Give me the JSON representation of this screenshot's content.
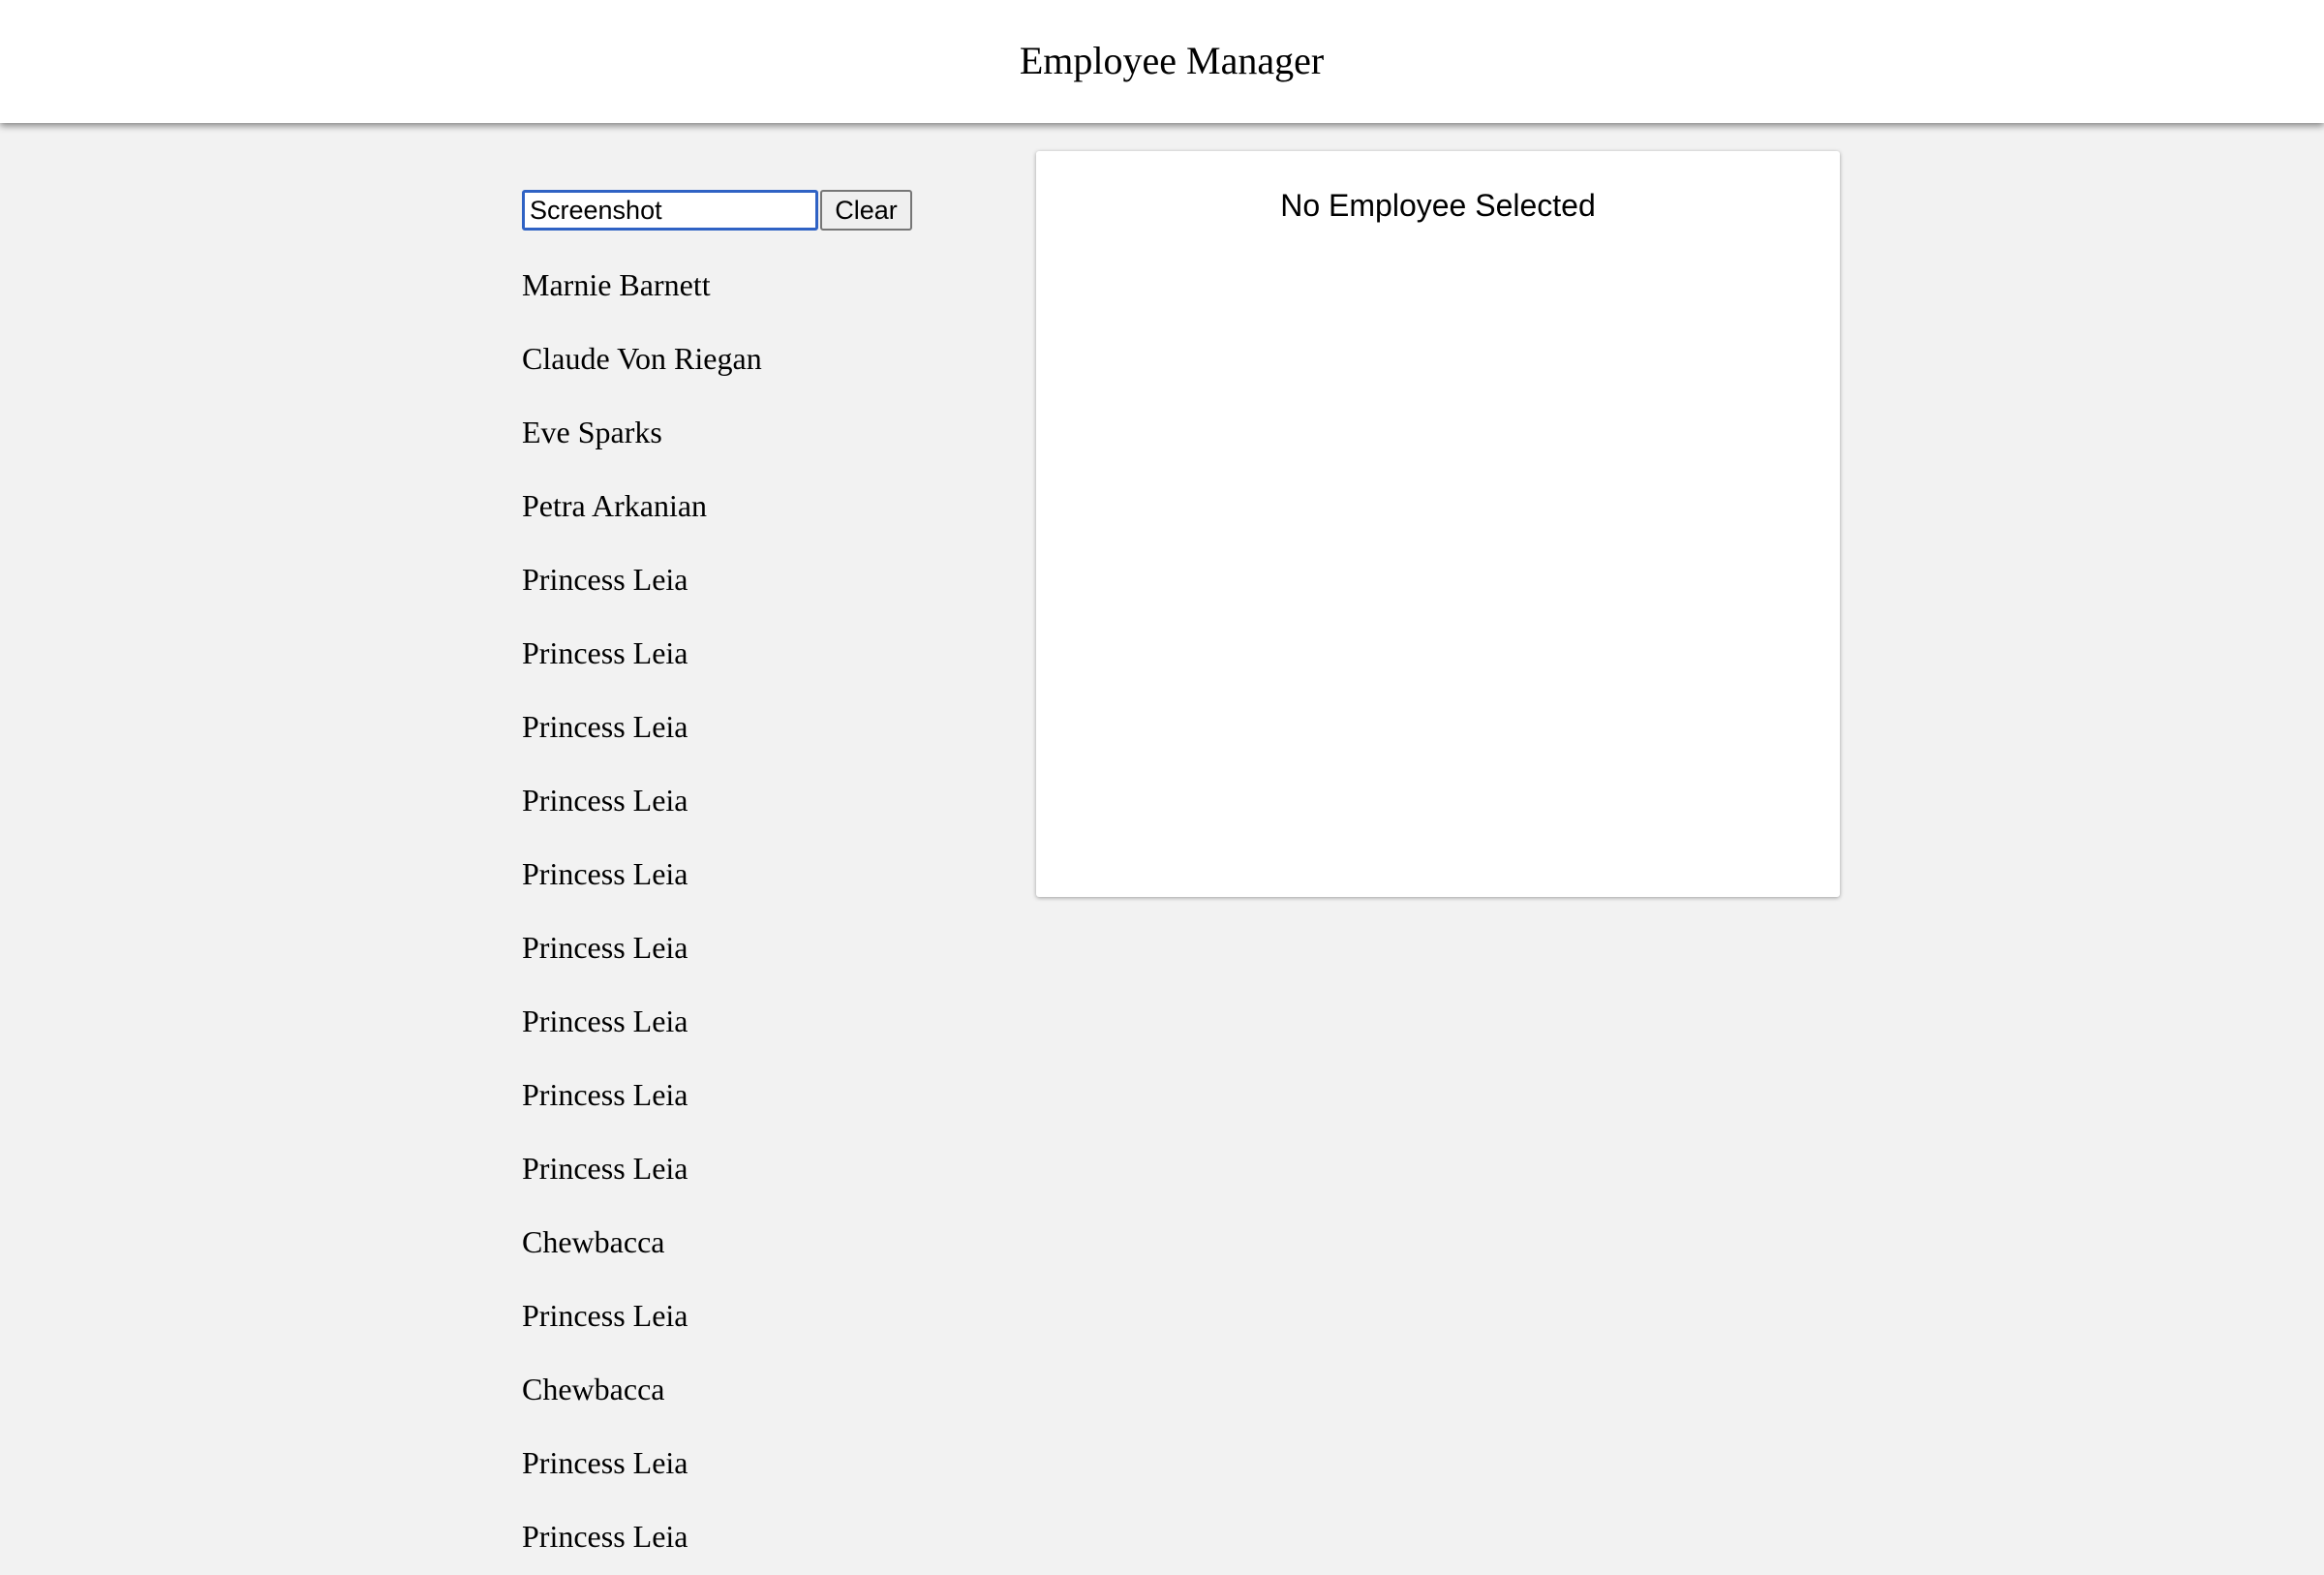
{
  "header": {
    "title": "Employee Manager"
  },
  "search": {
    "value": "Screenshot",
    "clear_label": "Clear"
  },
  "employees": [
    "Marnie Barnett",
    "Claude Von Riegan",
    "Eve Sparks",
    "Petra Arkanian",
    "Princess Leia",
    "Princess Leia",
    "Princess Leia",
    "Princess Leia",
    "Princess Leia",
    "Princess Leia",
    "Princess Leia",
    "Princess Leia",
    "Princess Leia",
    "Chewbacca",
    "Princess Leia",
    "Chewbacca",
    "Princess Leia",
    "Princess Leia"
  ],
  "detail": {
    "message": "No Employee Selected"
  },
  "colors": {
    "background": "#f2f2f2",
    "panel": "#ffffff",
    "focus_ring": "#2f62c4"
  }
}
